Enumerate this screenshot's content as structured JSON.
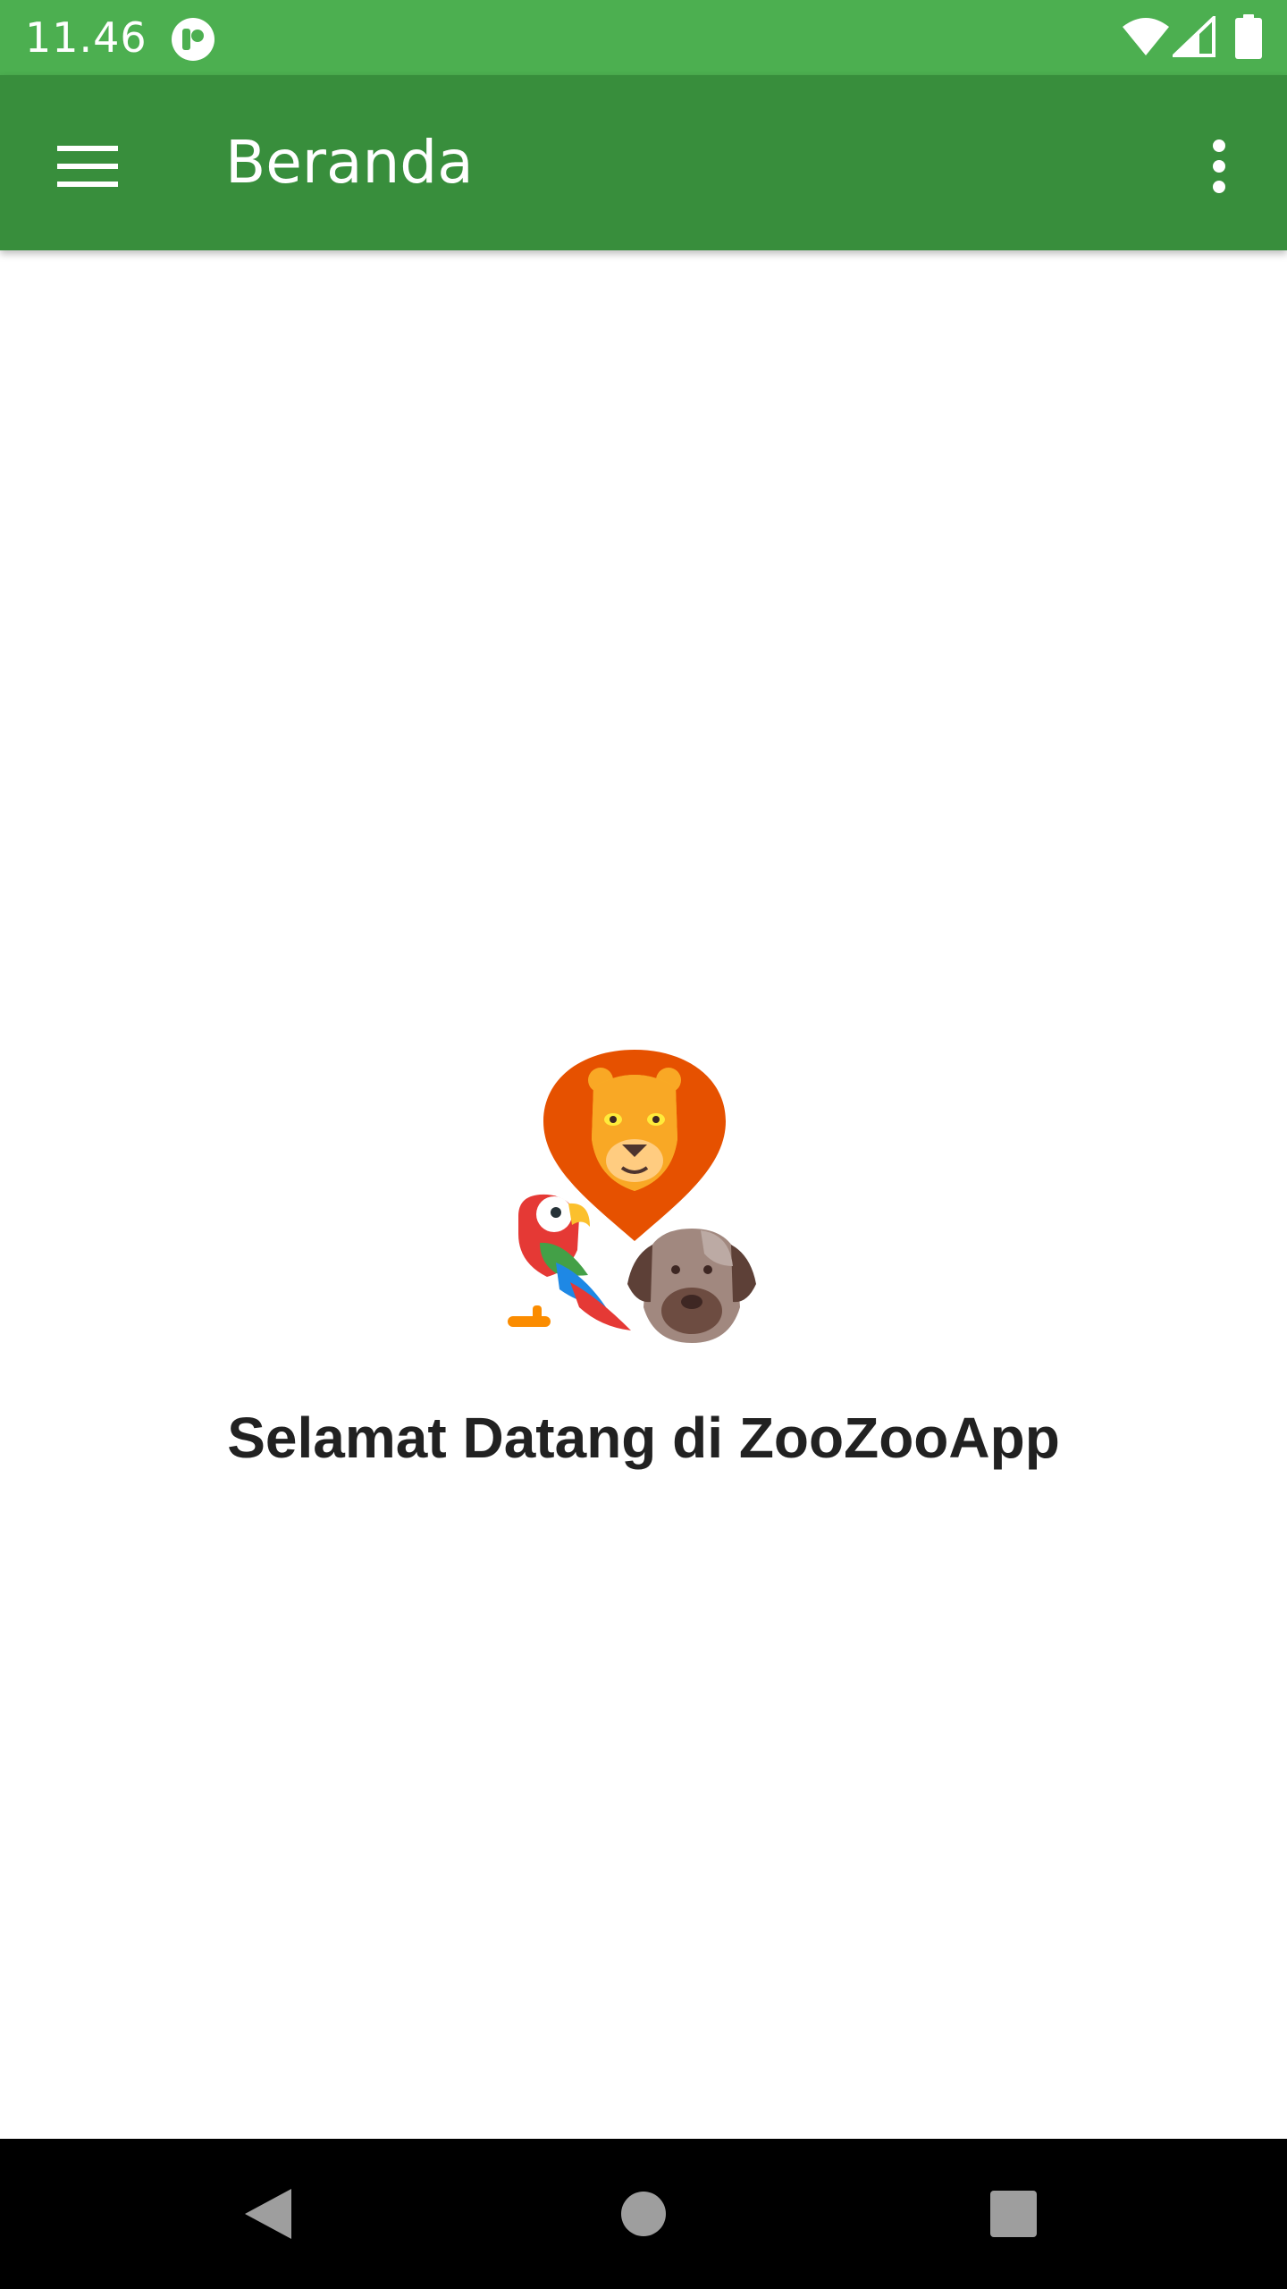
{
  "status_bar": {
    "time": "11.46",
    "icons": [
      "app-notification-icon",
      "wifi-icon",
      "signal-icon",
      "battery-icon"
    ],
    "color": "#4CAF50"
  },
  "app_bar": {
    "title": "Beranda",
    "nav_icon": "menu-icon",
    "overflow_icon": "more-vert-icon",
    "color": "#388E3C"
  },
  "main": {
    "logo_icon": "zoo-animals-logo",
    "welcome_text": "Selamat Datang di ZooZooApp"
  },
  "navigation_bar": {
    "buttons": [
      "back-icon",
      "home-icon",
      "recents-icon"
    ]
  }
}
